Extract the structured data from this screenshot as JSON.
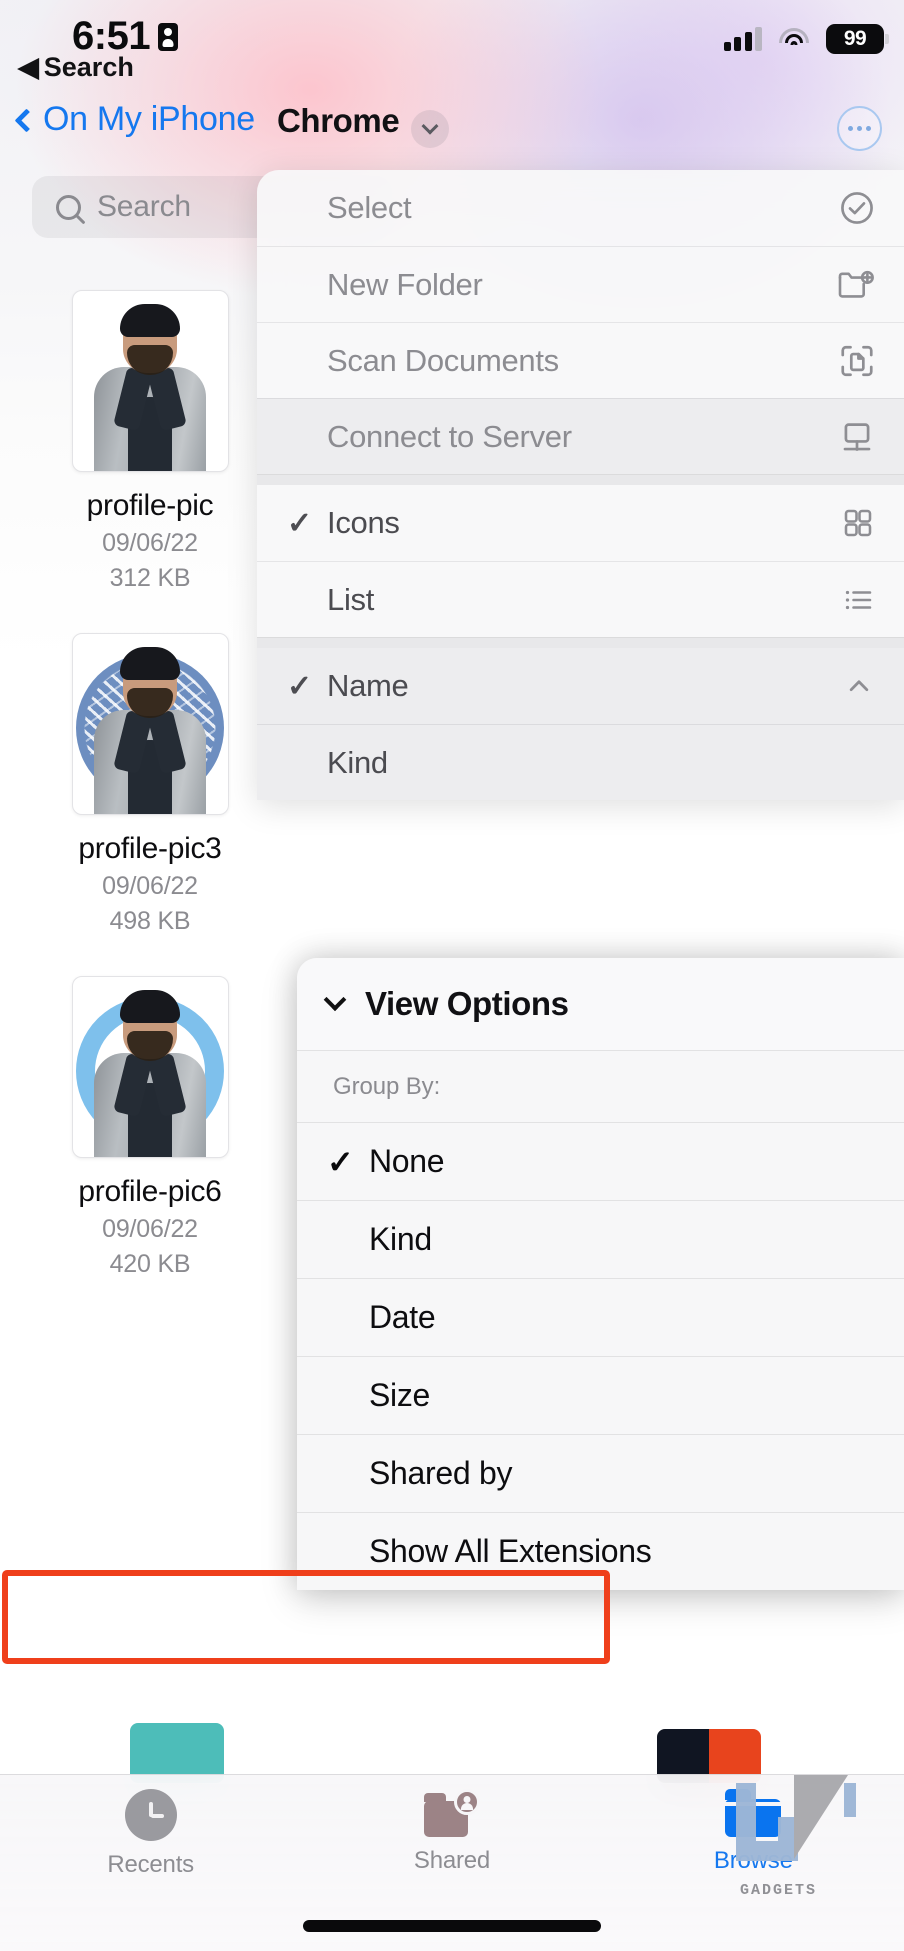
{
  "status_bar": {
    "time": "6:51",
    "back_label": "Search",
    "battery": "99",
    "icons": [
      "lock-portrait-icon",
      "cellular-signal-icon",
      "wifi-icon",
      "battery-icon"
    ]
  },
  "nav_bar": {
    "back_label": "On My iPhone",
    "title": "Chrome",
    "dropdown_icon": "chevron-down-icon",
    "more_icon": "ellipsis-circle-icon",
    "accent_color": "#1578ef"
  },
  "search": {
    "placeholder": "Search",
    "icon": "search-icon"
  },
  "files": [
    {
      "name": "profile-pic",
      "date": "09/06/22",
      "size": "312 KB",
      "style": "plain"
    },
    {
      "name": "profile-pic3",
      "date": "09/06/22",
      "size": "498 KB",
      "style": "confetti"
    },
    {
      "name": "profile-pic6",
      "date": "09/06/22",
      "size": "420 KB",
      "style": "ring"
    }
  ],
  "context_menu": {
    "items": [
      {
        "label": "Select",
        "icon": "checkmark-circle-icon",
        "checked": false,
        "highlighted": false
      },
      {
        "label": "New Folder",
        "icon": "folder-plus-icon",
        "checked": false,
        "highlighted": false
      },
      {
        "label": "Scan Documents",
        "icon": "scan-document-icon",
        "checked": false,
        "highlighted": false
      },
      {
        "label": "Connect to Server",
        "icon": "display-server-icon",
        "checked": false,
        "highlighted": true
      }
    ],
    "view_items": [
      {
        "label": "Icons",
        "icon": "grid-icon",
        "checked": true
      },
      {
        "label": "List",
        "icon": "list-icon",
        "checked": false
      }
    ],
    "sort_items": [
      {
        "label": "Name",
        "icon": "chevron-up-icon",
        "checked": true,
        "highlighted": true
      },
      {
        "label": "Kind",
        "icon": "",
        "checked": false,
        "highlighted": true
      }
    ]
  },
  "view_options": {
    "title": "View Options",
    "collapse_icon": "chevron-down-icon",
    "group_by_label": "Group By:",
    "options": [
      {
        "label": "None",
        "checked": true
      },
      {
        "label": "Kind",
        "checked": false
      },
      {
        "label": "Date",
        "checked": false
      },
      {
        "label": "Size",
        "checked": false
      },
      {
        "label": "Shared by",
        "checked": false
      }
    ],
    "extensions_label": "Show All Extensions",
    "highlight_color": "#ef3f1b"
  },
  "tab_bar": {
    "tabs": [
      {
        "label": "Recents",
        "icon": "clock-icon",
        "active": false
      },
      {
        "label": "Shared",
        "icon": "shared-folder-icon",
        "active": false
      },
      {
        "label": "Browse",
        "icon": "folder-icon",
        "active": true
      }
    ],
    "active_color": "#1578ef"
  },
  "watermark": {
    "text": "GADGETS"
  }
}
